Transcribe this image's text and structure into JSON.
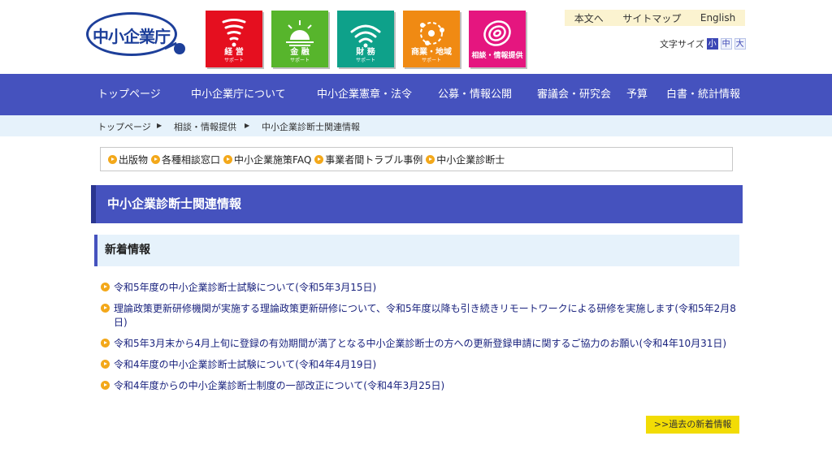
{
  "header": {
    "logo_text": "中小企業庁",
    "categories": [
      {
        "title": "経 営",
        "sub": "サポート",
        "icon": "tornado-icon",
        "color": "#e50f1f"
      },
      {
        "title": "金 融",
        "sub": "サポート",
        "icon": "sunrise-icon",
        "color": "#57b52c"
      },
      {
        "title": "財 務",
        "sub": "サポート",
        "icon": "wifi-icon",
        "color": "#0ea18a"
      },
      {
        "title": "商業・地域",
        "sub": "サポート",
        "icon": "orbit-icon",
        "color": "#f08a13"
      },
      {
        "title": "相談・情報提供",
        "sub": "",
        "icon": "spiral-icon",
        "color": "#e5167f"
      }
    ],
    "util_links": [
      "本文へ",
      "サイトマップ",
      "English"
    ],
    "font_size_label": "文字サイズ",
    "font_sizes": [
      "小",
      "中",
      "大"
    ]
  },
  "nav": [
    "トップページ",
    "中小企業庁について",
    "中小企業憲章・法令",
    "公募・情報公開",
    "審議会・研究会",
    "予算",
    "白書・統計情報"
  ],
  "breadcrumb": [
    "トップページ",
    "相談・情報提供",
    "中小企業診断士関連情報"
  ],
  "sublinks": [
    "出版物",
    "各種相談窓口",
    "中小企業施策FAQ",
    "事業者間トラブル事例",
    "中小企業診断士"
  ],
  "page_title": "中小企業診断士関連情報",
  "section_title": "新着情報",
  "news": [
    "令和5年度の中小企業診断士試験について(令和5年3月15日)",
    "理論政策更新研修機関が実施する理論政策更新研修について、令和5年度以降も引き続きリモートワークによる研修を実施します(令和5年2月8日)",
    "令和5年3月末から4月上旬に登録の有効期間が満了となる中小企業診断士の方への更新登録申請に関するご協力のお願い(令和4年10月31日)",
    "令和4年度の中小企業診断士試験について(令和4年4月19日)",
    "令和4年度からの中小企業診断士制度の一部改正について(令和4年3月25日)"
  ],
  "more_label": ">>過去の新着情報",
  "colors": {
    "nav": "#4552be",
    "light": "#e6f2fb",
    "accent": "#f3a81a",
    "more": "#f2dc05"
  }
}
